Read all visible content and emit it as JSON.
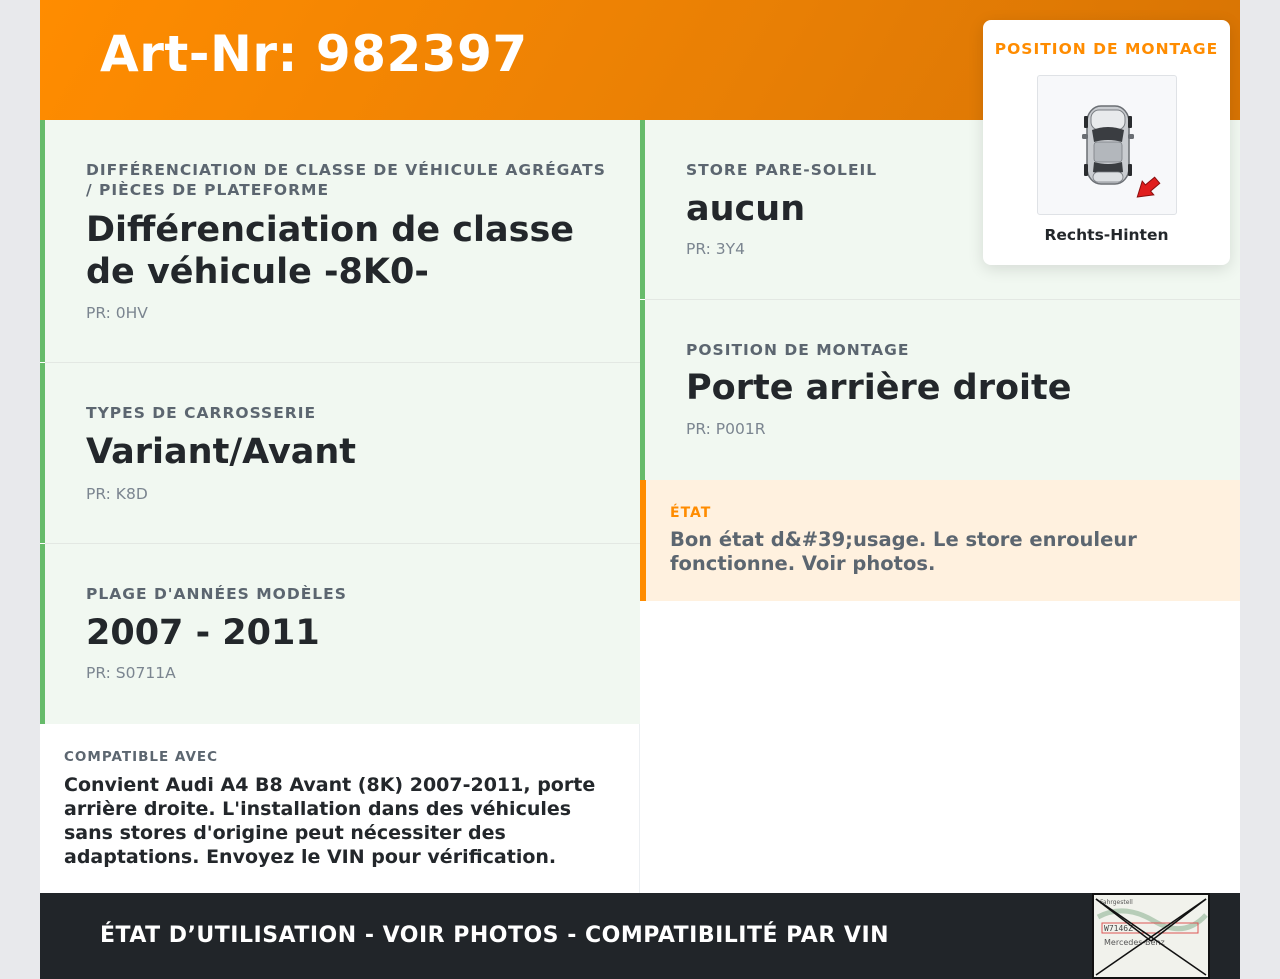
{
  "header": {
    "title": "Art-Nr: 982397"
  },
  "cards_left": [
    {
      "label": "DIFFÉRENCIATION DE CLASSE DE VÉHICULE AGRÉGATS / PIÈCES DE PLATEFORME",
      "value": "Différenciation de classe de véhicule -8K0-",
      "pr": "PR: 0HV"
    },
    {
      "label": "TYPES DE CARROSSERIE",
      "value": "Variant/Avant",
      "pr": "PR: K8D"
    },
    {
      "label": "PLAGE D'ANNÉES MODÈLES",
      "value": "2007 - 2011",
      "pr": "PR: S0711A"
    }
  ],
  "cards_right": [
    {
      "label": "STORE PARE-SOLEIL",
      "value": "aucun",
      "pr": "PR: 3Y4"
    },
    {
      "label": "POSITION DE MONTAGE",
      "value": "Porte arrière droite",
      "pr": "PR: P001R"
    }
  ],
  "state": {
    "label": "ÉTAT",
    "text": "Bon état d&#39;usage. Le store enrouleur fonctionne. Voir photos."
  },
  "compat": {
    "label": "COMPATIBLE AVEC",
    "text": "Convient Audi A4 B8 Avant (8K) 2007-2011, porte arrière droite. L'installation dans des véhicules sans stores d'origine peut nécessiter des adaptations. Envoyez le VIN pour vérification."
  },
  "mount_card": {
    "label": "POSITION DE MONTAGE",
    "caption": "Rechts-Hinten",
    "image_icon": "car-top-view-icon"
  },
  "footer": {
    "text": "ÉTAT D’UTILISATION - VOIR PHOTOS - COMPATIBILITÉ PAR VIN",
    "thumb_text_top": "Fahrgestell",
    "thumb_text_mid": "W7146Z",
    "thumb_text_bottom": "Mercedes-Benz"
  },
  "colors": {
    "accent": "#ff8c00",
    "card_bg": "#f1f8f1",
    "card_border": "#66bb6a",
    "state_bg": "#fff1df",
    "footer_bg": "#212529"
  }
}
